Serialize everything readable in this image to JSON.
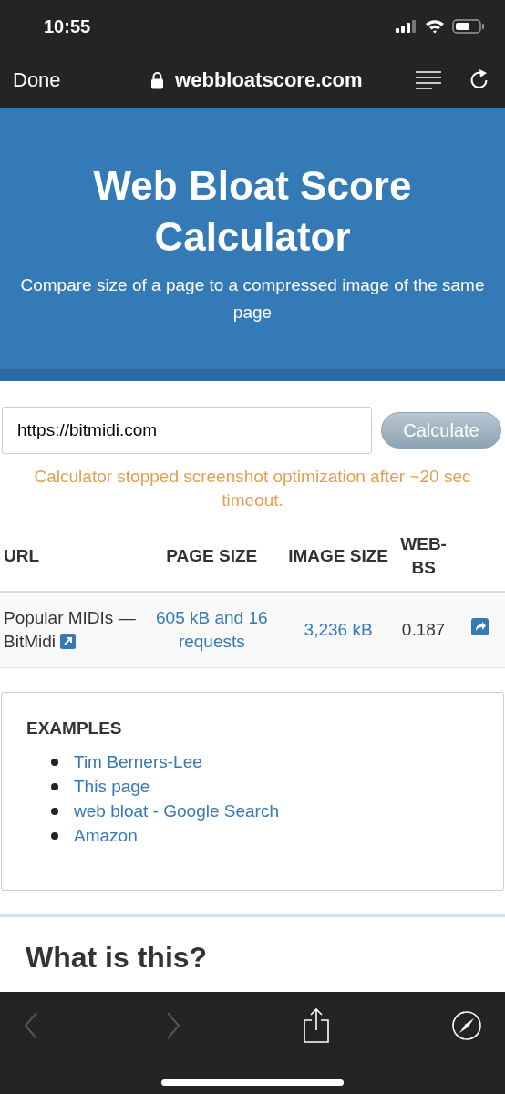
{
  "status_bar": {
    "time": "10:55"
  },
  "browser_bar": {
    "done": "Done",
    "domain": "webbloatscore.com"
  },
  "header": {
    "title": "Web Bloat Score Calculator",
    "subtitle": "Compare size of a page to a compressed image of the same page"
  },
  "form": {
    "url_value": "https://bitmidi.com",
    "button": "Calculate"
  },
  "warning": "Calculator stopped screenshot optimization after ~20 sec timeout.",
  "table": {
    "columns": [
      "URL",
      "PAGE SIZE",
      "IMAGE SIZE",
      "WEB-BS"
    ],
    "rows": [
      {
        "url": "Popular MIDIs — BitMidi",
        "page_size": "605 kB and 16 requests",
        "image_size": "3,236 kB",
        "web_bs": "0.187"
      }
    ]
  },
  "examples": {
    "title": "EXAMPLES",
    "items": [
      "Tim Berners-Lee",
      "This page",
      "web bloat - Google Search",
      "Amazon"
    ]
  },
  "section_title": "What is this?",
  "toolbar": {
    "back_disabled": true,
    "forward_disabled": true
  }
}
